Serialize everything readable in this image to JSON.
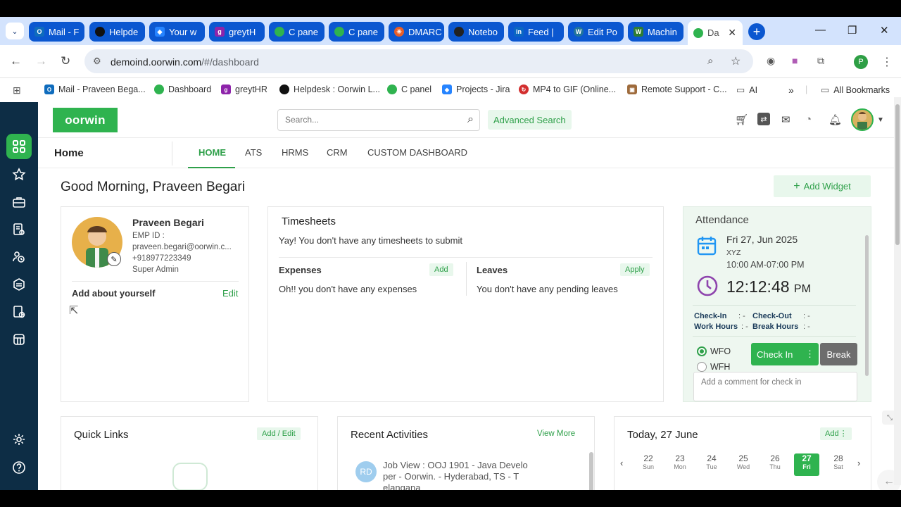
{
  "browser": {
    "tabs": [
      {
        "label": "Mail - F",
        "color": "#0f6cbd",
        "icon": "outlook-icon"
      },
      {
        "label": "Helpde",
        "color": "#111111",
        "icon": "helpdesk-icon"
      },
      {
        "label": "Your w",
        "color": "#2684ff",
        "icon": "jira-icon"
      },
      {
        "label": "greytH",
        "color": "#8e24aa",
        "icon": "greythr-icon"
      },
      {
        "label": "C pane",
        "color": "#2fb34f",
        "icon": "cpanel-icon"
      },
      {
        "label": "C pane",
        "color": "#2fb34f",
        "icon": "cpanel-icon"
      },
      {
        "label": "DMARC",
        "color": "#e85d26",
        "icon": "dmarc-icon"
      },
      {
        "label": "Notebo",
        "color": "#222222",
        "icon": "notebook-icon"
      },
      {
        "label": "Feed |",
        "color": "#0a66c2",
        "icon": "linkedin-icon"
      },
      {
        "label": "Edit Po",
        "color": "#21759b",
        "icon": "wordpress-icon"
      },
      {
        "label": "Machin",
        "color": "#2e7d32",
        "icon": "machine-icon"
      },
      {
        "label": "Da",
        "color": "#2fb34f",
        "icon": "oorwin-icon"
      }
    ],
    "url_host": "demoind.oorwin.com",
    "url_path": "/#/dashboard",
    "profile_initial": "P",
    "bookmarks": [
      {
        "label": "Mail - Praveen Bega...",
        "color": "#0f6cbd"
      },
      {
        "label": "Dashboard",
        "color": "#2fb34f"
      },
      {
        "label": "greytHR",
        "color": "#8e24aa"
      },
      {
        "label": "Helpdesk : Oorwin L...",
        "color": "#111111"
      },
      {
        "label": "C panel",
        "color": "#2fb34f"
      },
      {
        "label": "Projects - Jira",
        "color": "#2684ff"
      },
      {
        "label": "MP4 to GIF (Online...",
        "color": "#d32f2f"
      },
      {
        "label": "Remote Support - C...",
        "color": "#9e6b3c"
      },
      {
        "label": "AI",
        "color": "#5f6368"
      }
    ],
    "more_bookmarks": "»",
    "all_bookmarks": "All Bookmarks"
  },
  "app": {
    "logo": "oorwin",
    "search_placeholder": "Search...",
    "advanced_search": "Advanced Search",
    "page_title": "Home",
    "tabs": [
      "HOME",
      "ATS",
      "HRMS",
      "CRM",
      "CUSTOM DASHBOARD"
    ],
    "greeting": "Good Morning, Praveen Begari",
    "add_widget": "Add Widget",
    "profile": {
      "name": "Praveen Begari",
      "emp_id": "EMP ID :",
      "email": "praveen.begari@oorwin.c...",
      "phone": "+918977223349",
      "role": "Super Admin",
      "about_label": "Add about yourself",
      "edit": "Edit"
    },
    "timesheets": {
      "title": "Timesheets",
      "message": "Yay! You don't have any timesheets to submit",
      "expenses_title": "Expenses",
      "expenses_add": "Add",
      "expenses_msg": "Oh!! you don't have any expenses",
      "leaves_title": "Leaves",
      "leaves_apply": "Apply",
      "leaves_msg": "You don't have any pending leaves"
    },
    "attendance": {
      "title": "Attendance",
      "date": "Fri 27, Jun 2025",
      "shift": "XYZ",
      "hours": "10:00 AM-07:00 PM",
      "time": "12:12:48",
      "ampm": "PM",
      "check_in_label": "Check-In",
      "check_in_value": ": -",
      "check_out_label": "Check-Out",
      "check_out_value": ": -",
      "work_hours_label": "Work Hours",
      "work_hours_value": ": -",
      "break_hours_label": "Break Hours",
      "break_hours_value": ": -",
      "wfo": "WFO",
      "wfh": "WFH",
      "check_in_btn": "Check In",
      "break_btn": "Break",
      "comment_placeholder": "Add a comment for check in"
    },
    "quick_links": {
      "title": "Quick Links",
      "action": "Add / Edit"
    },
    "recent": {
      "title": "Recent Activities",
      "action": "View More",
      "initials": "RD",
      "item_line1": "Job View : OOJ 1901 - Java Develo",
      "item_line2": "per - Oorwin. - Hyderabad, TS - T",
      "item_line3": "elangana"
    },
    "today": {
      "title": "Today, 27 June",
      "action": "Add",
      "days": [
        {
          "n": "22",
          "d": "Sun"
        },
        {
          "n": "23",
          "d": "Mon"
        },
        {
          "n": "24",
          "d": "Tue"
        },
        {
          "n": "25",
          "d": "Wed"
        },
        {
          "n": "26",
          "d": "Thu"
        },
        {
          "n": "27",
          "d": "Fri"
        },
        {
          "n": "28",
          "d": "Sat"
        }
      ]
    }
  }
}
